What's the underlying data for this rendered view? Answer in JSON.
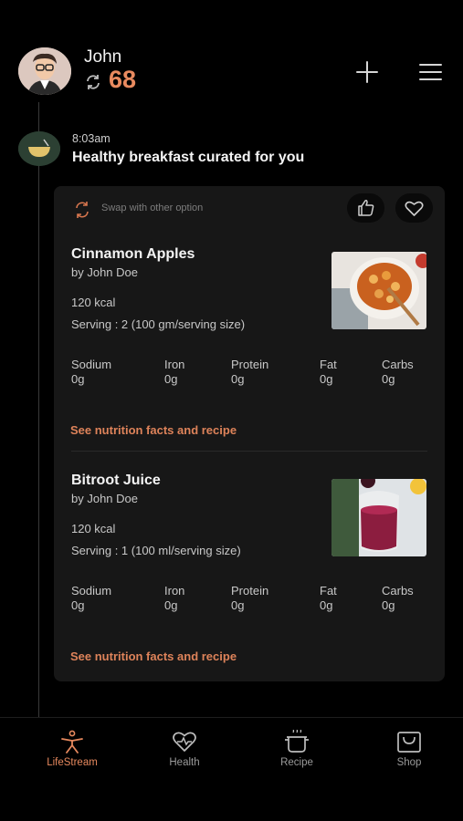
{
  "user": {
    "name": "John",
    "score": "68"
  },
  "feed": {
    "time": "8:03am",
    "headline": "Healthy breakfast curated for you"
  },
  "card": {
    "swap_label": "Swap with other option",
    "items": [
      {
        "title": "Cinnamon Apples",
        "author": "by John Doe",
        "kcal": "120 kcal",
        "serving": "Serving : 2 (100 gm/serving size)",
        "nutrients": [
          {
            "label": "Sodium",
            "value": "0g"
          },
          {
            "label": "Iron",
            "value": "0g"
          },
          {
            "label": "Protein",
            "value": "0g"
          },
          {
            "label": "Fat",
            "value": "0g"
          },
          {
            "label": "Carbs",
            "value": "0g"
          }
        ],
        "link": "See nutrition facts and recipe"
      },
      {
        "title": "Bitroot Juice",
        "author": "by John Doe",
        "kcal": "120 kcal",
        "serving": "Serving : 1 (100 ml/serving size)",
        "nutrients": [
          {
            "label": "Sodium",
            "value": "0g"
          },
          {
            "label": "Iron",
            "value": "0g"
          },
          {
            "label": "Protein",
            "value": "0g"
          },
          {
            "label": "Fat",
            "value": "0g"
          },
          {
            "label": "Carbs",
            "value": "0g"
          }
        ],
        "link": "See nutrition facts and recipe"
      }
    ]
  },
  "nav": [
    {
      "label": "LifeStream",
      "icon": "person-stretch-icon",
      "active": true
    },
    {
      "label": "Health",
      "icon": "heart-pulse-icon",
      "active": false
    },
    {
      "label": "Recipe",
      "icon": "cooking-pot-icon",
      "active": false
    },
    {
      "label": "Shop",
      "icon": "shopping-bag-icon",
      "active": false
    }
  ],
  "colors": {
    "accent": "#e98a5f",
    "background": "#000000",
    "card": "#171717"
  }
}
